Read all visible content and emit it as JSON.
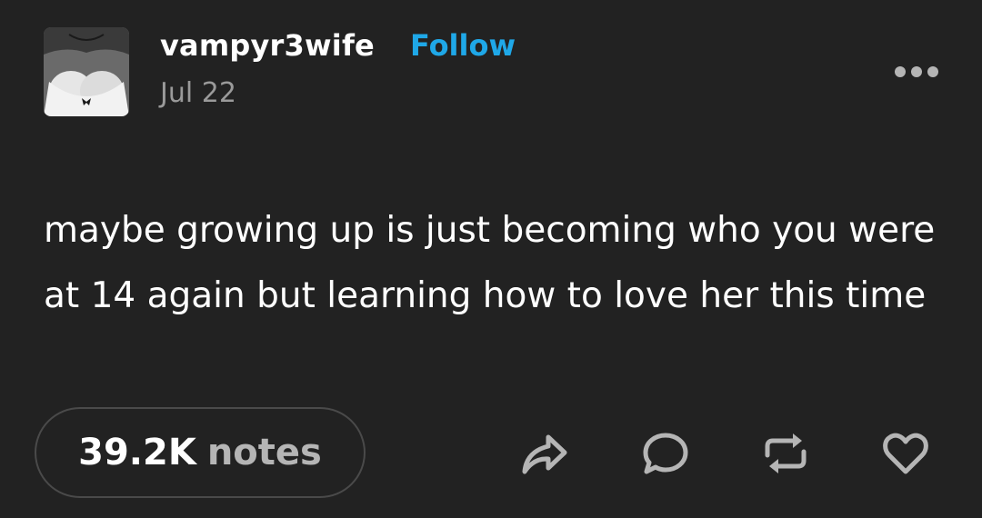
{
  "post": {
    "author": {
      "username": "vampyr3wife",
      "follow_label": "Follow",
      "avatar_icon": "avatar-photo"
    },
    "date": "Jul 22",
    "more_icon": "more-horizontal-icon",
    "body_text": "maybe growing up is just becoming who you were at 14 again but learning how to love her this time",
    "notes": {
      "count": "39.2K",
      "label": "notes"
    },
    "actions": [
      {
        "name": "share",
        "icon": "share-icon"
      },
      {
        "name": "reply",
        "icon": "reply-icon"
      },
      {
        "name": "reblog",
        "icon": "reblog-icon"
      },
      {
        "name": "like",
        "icon": "heart-icon"
      }
    ]
  },
  "colors": {
    "background": "#222222",
    "text": "#ffffff",
    "follow": "#1fa8e8",
    "muted": "#9a9a9a",
    "border": "#4a4a4a"
  }
}
